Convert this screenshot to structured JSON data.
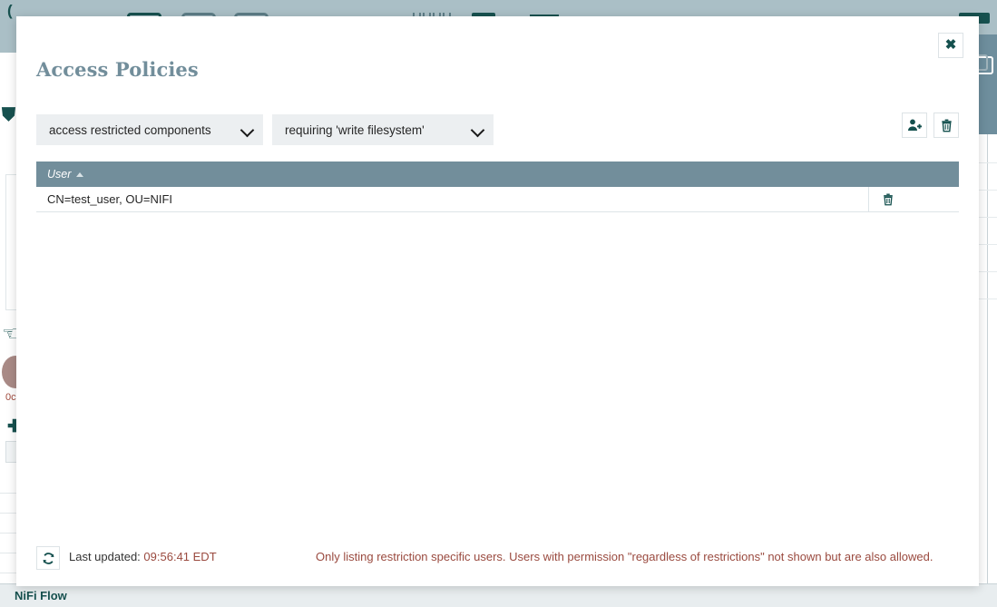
{
  "background": {
    "toolbar": {
      "icons": [
        "processor-icon",
        "input-port-icon",
        "output-port-icon",
        "process-group-icon",
        "remote-process-group-icon",
        "funnel-icon",
        "template-icon",
        "label-icon"
      ]
    },
    "side_labels": {
      "gauge_value": "0c"
    },
    "breadcrumb": {
      "label": "NiFi Flow"
    }
  },
  "dialog": {
    "title": "Access Policies",
    "close_label": "✖",
    "filters": {
      "scope": {
        "value": "access restricted components",
        "icon": "chevron-down-icon"
      },
      "action": {
        "value": "requiring 'write filesystem'",
        "icon": "chevron-down-icon"
      }
    },
    "actions": {
      "add_user_label": "add-user-icon",
      "delete_label": "trash-icon"
    },
    "table": {
      "columns": [
        {
          "label": "User",
          "sort": "asc"
        }
      ],
      "rows": [
        {
          "user": "CN=test_user, OU=NIFI",
          "action_icon": "trash-icon"
        }
      ]
    },
    "footer": {
      "refresh_icon": "refresh-icon",
      "last_updated_label": "Last updated:",
      "last_updated_value": "09:56:41 EDT",
      "note": "Only listing restriction specific users. Users with permission \"regardless of restrictions\" not shown but are also allowed."
    }
  },
  "colors": {
    "header_blue": "#728e9b",
    "accent_teal": "#14504e",
    "note_red": "#9a4a3f",
    "toolbar_grey": "#aabfc6"
  }
}
